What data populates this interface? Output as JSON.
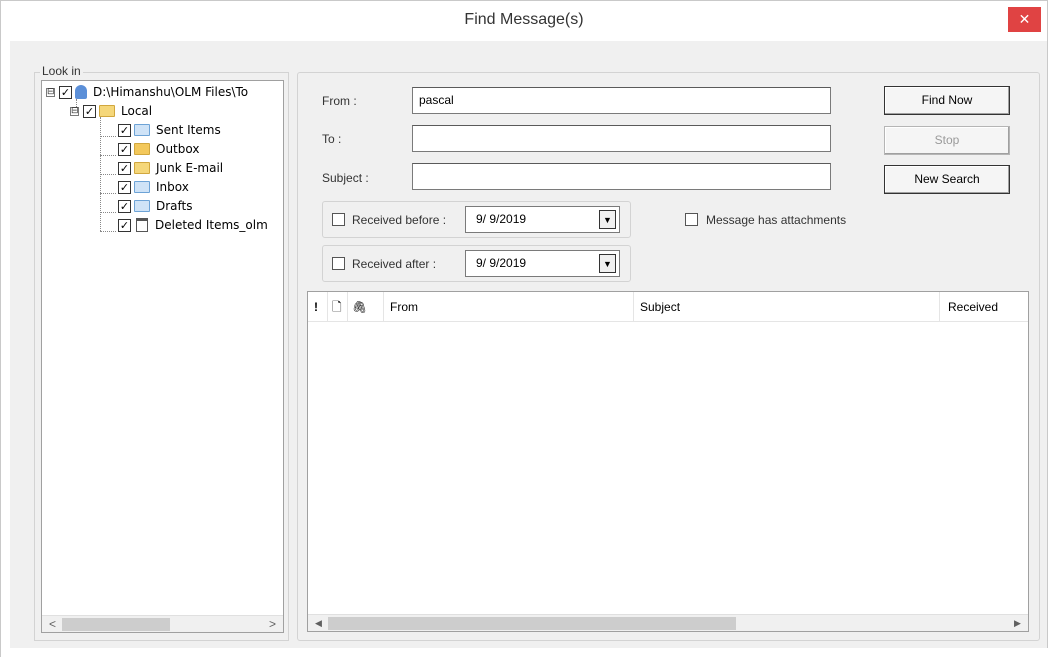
{
  "window": {
    "title": "Find Message(s)",
    "close_glyph": "✕"
  },
  "look_in": {
    "label": "Look in",
    "tree": [
      {
        "label": "D:\\Himanshu\\OLM Files\\To",
        "icon": "drive-icon",
        "checked": true,
        "expander": "⊟"
      },
      {
        "label": "Local",
        "icon": "folder-icon",
        "checked": true,
        "expander": "⊟"
      },
      {
        "label": "Sent Items",
        "icon": "sent-items-icon",
        "checked": true
      },
      {
        "label": "Outbox",
        "icon": "outbox-icon",
        "checked": true
      },
      {
        "label": "Junk E-mail",
        "icon": "folder-icon",
        "checked": true
      },
      {
        "label": "Inbox",
        "icon": "inbox-icon",
        "checked": true
      },
      {
        "label": "Drafts",
        "icon": "drafts-icon",
        "checked": true
      },
      {
        "label": "Deleted Items_olm",
        "icon": "trash-icon",
        "checked": true
      }
    ],
    "scroll_left": "<",
    "scroll_right": ">"
  },
  "search": {
    "from_label": "From :",
    "from_value": "pascal",
    "to_label": "To :",
    "to_value": "",
    "subject_label": "Subject :",
    "subject_value": "",
    "received_before_label": "Received before :",
    "received_before_value": "9/ 9/2019",
    "received_after_label": "Received after :",
    "received_after_value": "9/ 9/2019",
    "attachments_label": "Message has attachments",
    "dropdown_glyph": "▼"
  },
  "buttons": {
    "find_now": "Find Now",
    "stop": "Stop",
    "new_search": "New Search"
  },
  "results": {
    "columns": {
      "importance": "!",
      "type": "🗋",
      "attachment": "🖇",
      "from": "From",
      "subject": "Subject",
      "received": "Received"
    },
    "rows": [],
    "scroll_left": "◀",
    "scroll_right": "▶"
  },
  "colors": {
    "close_button": "#e04343",
    "window_bg": "#f0f0f0"
  }
}
